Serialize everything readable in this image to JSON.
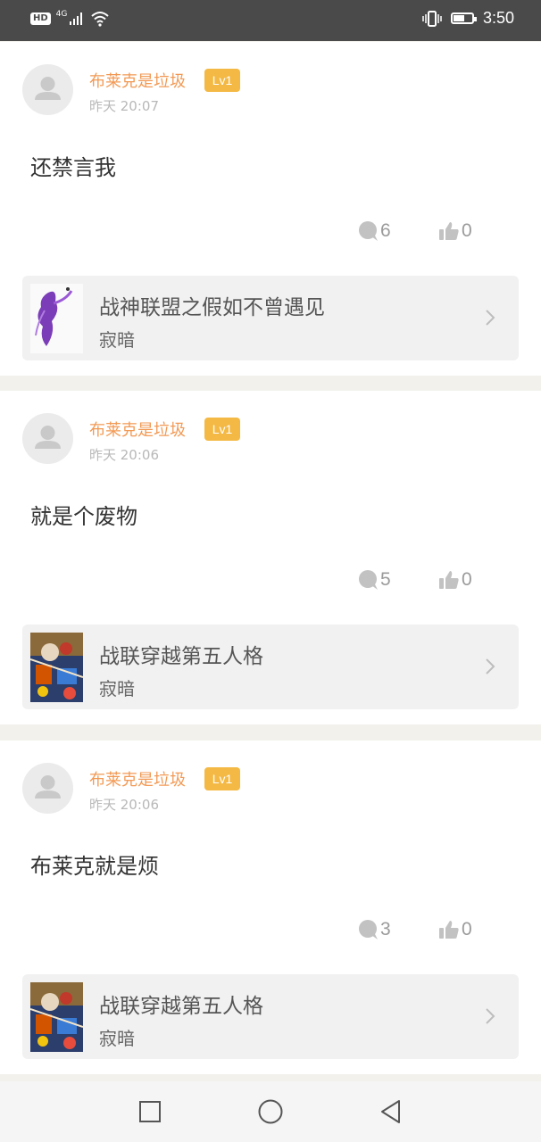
{
  "status_bar": {
    "network": "HD",
    "signal_type": "4G",
    "time": "3:50"
  },
  "posts": [
    {
      "user": "布莱克是垃圾",
      "level": "Lv1",
      "time": "昨天 20:07",
      "content": "还禁言我",
      "comments": "6",
      "likes": "0",
      "book": {
        "title": "战神联盟之假如不曾遇见",
        "author": "寂暗",
        "cover_icon": "purple-figure-cover"
      }
    },
    {
      "user": "布莱克是垃圾",
      "level": "Lv1",
      "time": "昨天 20:06",
      "content": "就是个废物",
      "comments": "5",
      "likes": "0",
      "book": {
        "title": "战联穿越第五人格",
        "author": "寂暗",
        "cover_icon": "colorful-art-cover"
      }
    },
    {
      "user": "布莱克是垃圾",
      "level": "Lv1",
      "time": "昨天 20:06",
      "content": "布莱克就是烦",
      "comments": "3",
      "likes": "0",
      "book": {
        "title": "战联穿越第五人格",
        "author": "寂暗",
        "cover_icon": "colorful-art-cover"
      }
    }
  ],
  "colors": {
    "username": "#f29a55",
    "level_badge": "#f4b944",
    "separator": "#f2f1ec",
    "status_bar": "#4a4a4a"
  },
  "nav": {
    "recent_icon": "square-icon",
    "home_icon": "circle-icon",
    "back_icon": "triangle-back-icon"
  }
}
